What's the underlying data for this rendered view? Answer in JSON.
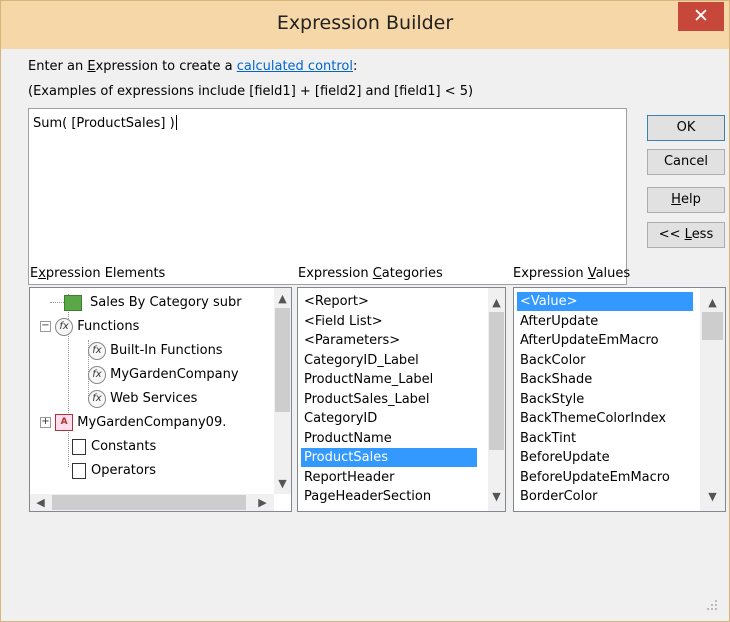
{
  "window": {
    "title": "Expression Builder",
    "close_glyph": "✕"
  },
  "prompt": {
    "prefix": "Enter an ",
    "expr_word": "E",
    "expr_rest": "xpression to create a ",
    "link": "calculated control",
    "suffix": ":",
    "examples": "(Examples of expressions include [field1] + [field2] and [field1] < 5)"
  },
  "expression": {
    "value": "Sum( [ProductSales] )"
  },
  "buttons": {
    "ok": "OK",
    "cancel": "Cancel",
    "help_u": "H",
    "help_rest": "elp",
    "less_prefix": "<< ",
    "less_u": "L",
    "less_rest": "ess"
  },
  "panels": {
    "elements": {
      "label_prefix": "E",
      "label_u": "x",
      "label_rest": "pression Elements",
      "items": [
        {
          "label": "Sales By Category subr",
          "icon": "form-icon"
        },
        {
          "label": "Functions",
          "icon": "function-icon",
          "expander": "−"
        },
        {
          "label": "Built-In Functions",
          "icon": "function-icon"
        },
        {
          "label": "MyGardenCompany",
          "icon": "function-icon"
        },
        {
          "label": "Web Services",
          "icon": "function-icon"
        },
        {
          "label": "MyGardenCompany09.",
          "icon": "database-icon",
          "expander": "+"
        },
        {
          "label": "Constants",
          "icon": "constants-icon"
        },
        {
          "label": "Operators",
          "icon": "operators-icon"
        }
      ]
    },
    "categories": {
      "label_prefix": "Expression ",
      "label_u": "C",
      "label_rest": "ategories",
      "items": [
        "<Report>",
        "<Field List>",
        "<Parameters>",
        "CategoryID_Label",
        "ProductName_Label",
        "ProductSales_Label",
        "CategoryID",
        "ProductName",
        "ProductSales",
        "ReportHeader",
        "PageHeaderSection"
      ],
      "selected_index": 8
    },
    "values": {
      "label_prefix": "Expression ",
      "label_u": "V",
      "label_rest": "alues",
      "items": [
        "<Value>",
        "AfterUpdate",
        "AfterUpdateEmMacro",
        "BackColor",
        "BackShade",
        "BackStyle",
        "BackThemeColorIndex",
        "BackTint",
        "BeforeUpdate",
        "BeforeUpdateEmMacro",
        "BorderColor"
      ],
      "selected_index": 0
    }
  },
  "colors": {
    "titlebar": "#f6d7a8",
    "close_button": "#c7473a",
    "selection": "#3399ff",
    "link": "#0066cc"
  }
}
